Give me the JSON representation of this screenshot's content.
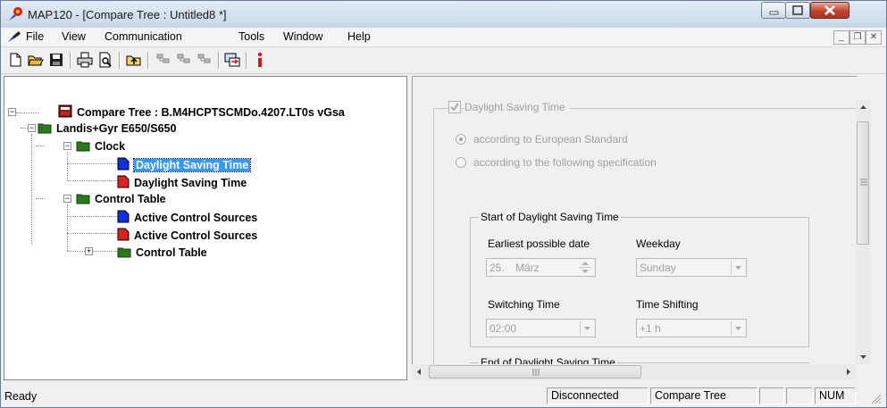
{
  "window": {
    "title": "MAP120 - [Compare Tree : Untitled8 *]"
  },
  "menu": {
    "items": [
      "File",
      "View",
      "Communication",
      "Tools",
      "Window",
      "Help"
    ]
  },
  "tree": {
    "root": "Compare Tree : B.M4HCPTSCMDo.4207.LT0s vGsa",
    "device": "Landis+Gyr E650/S650",
    "clock": "Clock",
    "dst_blue": "Daylight Saving Time",
    "dst_red": "Daylight Saving Time",
    "control_table": "Control Table",
    "acs_blue": "Active Control Sources",
    "acs_red": "Active Control Sources",
    "control_table_sub": "Control Table"
  },
  "panel": {
    "checkbox_label": "Daylight Saving Time",
    "radio1": "according to European Standard",
    "radio2": "according to the following specification",
    "start_group": "Start of Daylight Saving Time",
    "earliest_label": "Earliest possible date",
    "weekday_label": "Weekday",
    "date_day": "25.",
    "date_month": "März",
    "weekday_value": "Sunday",
    "switching_label": "Switching Time",
    "shifting_label": "Time Shifting",
    "switching_value": "02:00",
    "shifting_value": "+1 h",
    "end_group": "End of Daylight Saving Time"
  },
  "status": {
    "ready": "Ready",
    "connection": "Disconnected",
    "view": "Compare Tree",
    "num": "NUM"
  },
  "colors": {
    "blue_doc": "#1030e0",
    "red_doc": "#e02020",
    "folder": "#2a7a1c",
    "selection": "#3399ff",
    "info": "#d01818"
  }
}
